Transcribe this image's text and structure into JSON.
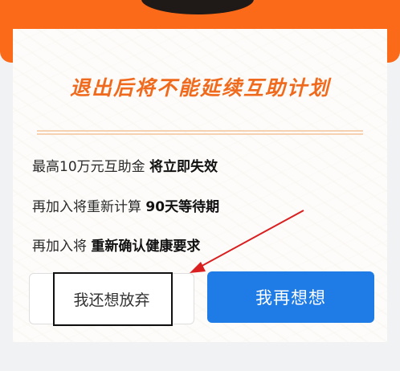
{
  "dialog": {
    "title": "退出后将不能延续互助计划",
    "lines": [
      {
        "text": "最高10万元互助金 ",
        "emphasis": "将立即失效"
      },
      {
        "text": "再加入将重新计算 ",
        "emphasis": "90天等待期"
      },
      {
        "text": "再加入将 ",
        "emphasis": "重新确认健康要求"
      }
    ],
    "buttons": {
      "give_up": "我还想放弃",
      "think_again": "我再想想"
    }
  },
  "colors": {
    "accent_orange": "#fa6a18",
    "title_orange": "#f06a1d",
    "primary_blue": "#1f7be6",
    "annotation_red": "#d91f1f"
  }
}
